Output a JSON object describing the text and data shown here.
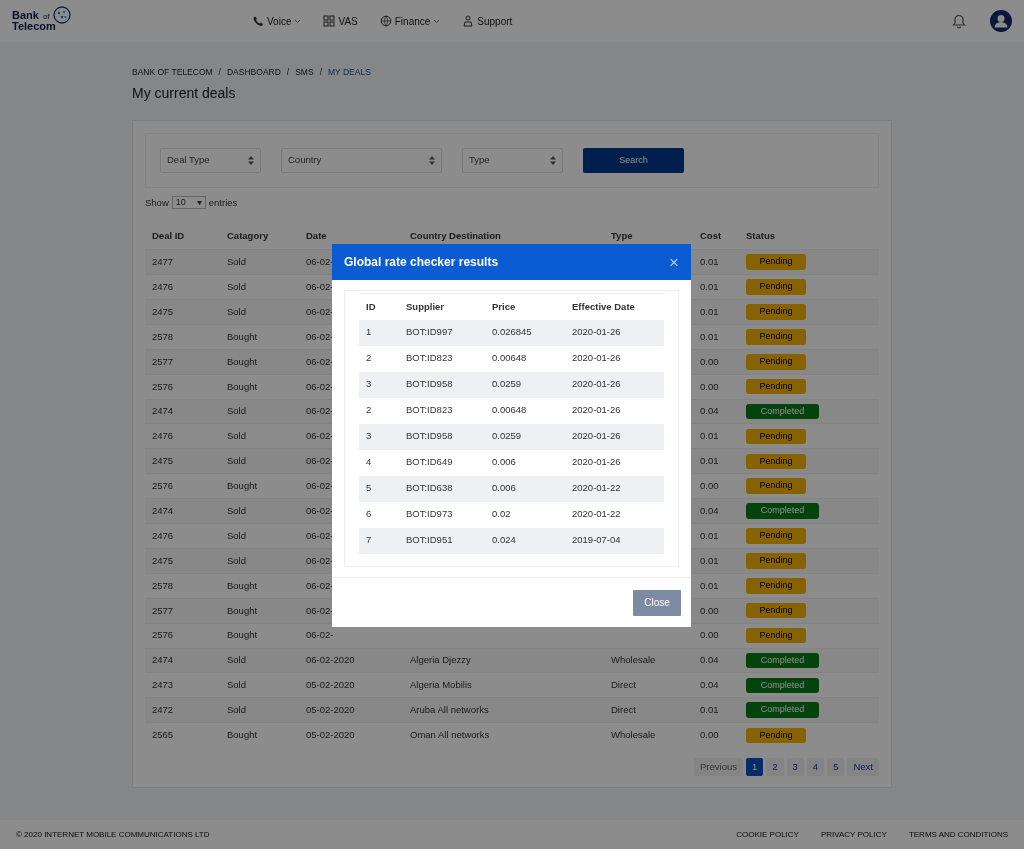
{
  "brand": {
    "line1": "Bank",
    "small": "of",
    "line2": "Telecom"
  },
  "nav": [
    {
      "label": "Voice",
      "kind": "phone",
      "dropdown": true
    },
    {
      "label": "VAS",
      "kind": "grid",
      "dropdown": false
    },
    {
      "label": "Finance",
      "kind": "globe",
      "dropdown": true
    },
    {
      "label": "Support",
      "kind": "support",
      "dropdown": false
    }
  ],
  "breadcrumb_separator": "/",
  "breadcrumb": [
    {
      "label": "BANK OF TELECOM",
      "selected": false
    },
    {
      "label": "DASHBOARD",
      "selected": false
    },
    {
      "label": "SMS",
      "selected": false
    },
    {
      "label": "MY DEALS",
      "selected": true
    }
  ],
  "page_title": "My current deals",
  "filters": {
    "selects": [
      {
        "placeholder": "Deal Type"
      },
      {
        "placeholder": "Country"
      },
      {
        "placeholder": "Type"
      }
    ],
    "search_button": "Search"
  },
  "length": {
    "before": "Show",
    "value": "10",
    "after": "entries"
  },
  "table": {
    "columns": [
      "Deal ID",
      "Catagory",
      "Date",
      "Country Destination",
      "Type",
      "Cost",
      "Status"
    ],
    "rows": [
      {
        "id": "2477",
        "category": "Sold",
        "date": "06-02-",
        "cost": "0.01",
        "status": "Pending",
        "kind": "pending"
      },
      {
        "id": "2476",
        "category": "Sold",
        "date": "06-02-",
        "cost": "0.01",
        "status": "Pending",
        "kind": "pending"
      },
      {
        "id": "2475",
        "category": "Sold",
        "date": "06-02-",
        "cost": "0.01",
        "status": "Pending",
        "kind": "pending"
      },
      {
        "id": "2578",
        "category": "Bought",
        "date": "06-02-",
        "cost": "0.01",
        "status": "Pending",
        "kind": "pending"
      },
      {
        "id": "2577",
        "category": "Bought",
        "date": "06-02-",
        "cost": "0.00",
        "status": "Pending",
        "kind": "pending"
      },
      {
        "id": "2576",
        "category": "Bought",
        "date": "06-02-",
        "cost": "0.00",
        "status": "Pending",
        "kind": "pending"
      },
      {
        "id": "2474",
        "category": "Sold",
        "date": "06-02-",
        "cost": "0.04",
        "status": "Completed",
        "kind": "completed"
      },
      {
        "id": "2476",
        "category": "Sold",
        "date": "06-02-",
        "cost": "0.01",
        "status": "Pending",
        "kind": "pending"
      },
      {
        "id": "2475",
        "category": "Sold",
        "date": "06-02-",
        "cost": "0.01",
        "status": "Pending",
        "kind": "pending"
      },
      {
        "id": "2576",
        "category": "Bought",
        "date": "06-02-",
        "cost": "0.00",
        "status": "Pending",
        "kind": "pending"
      },
      {
        "id": "2474",
        "category": "Sold",
        "date": "06-02-",
        "cost": "0.04",
        "status": "Completed",
        "kind": "completed"
      },
      {
        "id": "2476",
        "category": "Sold",
        "date": "06-02-",
        "cost": "0.01",
        "status": "Pending",
        "kind": "pending"
      },
      {
        "id": "2475",
        "category": "Sold",
        "date": "06-02-",
        "cost": "0.01",
        "status": "Pending",
        "kind": "pending"
      },
      {
        "id": "2578",
        "category": "Bought",
        "date": "06-02-",
        "cost": "0.01",
        "status": "Pending",
        "kind": "pending"
      },
      {
        "id": "2577",
        "category": "Bought",
        "date": "06-02-",
        "cost": "0.00",
        "status": "Pending",
        "kind": "pending"
      },
      {
        "id": "2576",
        "category": "Bought",
        "date": "06-02-",
        "cost": "0.00",
        "status": "Pending",
        "kind": "pending"
      },
      {
        "id": "2474",
        "category": "Sold",
        "date": "06-02-2020",
        "country": "Algeria Djezzy",
        "type": "Wholesale",
        "cost": "0.04",
        "status": "Completed",
        "kind": "completed"
      },
      {
        "id": "2473",
        "category": "Sold",
        "date": "05-02-2020",
        "country": "Algeria Mobilis",
        "type": "Direct",
        "cost": "0.04",
        "status": "Completed",
        "kind": "completed"
      },
      {
        "id": "2472",
        "category": "Sold",
        "date": "05-02-2020",
        "country": "Aruba All networks",
        "type": "Direct",
        "cost": "0.01",
        "status": "Completed",
        "kind": "completed"
      },
      {
        "id": "2565",
        "category": "Bought",
        "date": "05-02-2020",
        "country": "Oman All networks",
        "type": "Wholesale",
        "cost": "0.00",
        "status": "Pending",
        "kind": "pending"
      }
    ]
  },
  "pagination": [
    {
      "label": "Previous",
      "selected": false,
      "disabled": true
    },
    {
      "label": "1",
      "selected": true,
      "disabled": false
    },
    {
      "label": "2",
      "selected": false,
      "disabled": false
    },
    {
      "label": "3",
      "selected": false,
      "disabled": false
    },
    {
      "label": "4",
      "selected": false,
      "disabled": false
    },
    {
      "label": "5",
      "selected": false,
      "disabled": false
    },
    {
      "label": "Next",
      "selected": false,
      "disabled": false
    }
  ],
  "footer": {
    "copyright": "© 2020 INTERNET MOBILE COMMUNICATIONS LTD",
    "links": [
      "COOKIE POLICY",
      "PRIVACY POLICY",
      "TERMS AND CONDITIONS"
    ]
  },
  "modal": {
    "title": "Global rate checker results",
    "close_icon": "×",
    "columns": [
      "ID",
      "Supplier",
      "Price",
      "Effective Date"
    ],
    "rows": [
      [
        "1",
        "BOT:ID997",
        "0.026845",
        "2020-01-26"
      ],
      [
        "2",
        "BOT:ID823",
        "0.00648",
        "2020-01-26"
      ],
      [
        "3",
        "BOT:ID958",
        "0.0259",
        "2020-01-26"
      ],
      [
        "2",
        "BOT:ID823",
        "0.00648",
        "2020-01-26"
      ],
      [
        "3",
        "BOT:ID958",
        "0.0259",
        "2020-01-26"
      ],
      [
        "4",
        "BOT:ID649",
        "0.006",
        "2020-01-26"
      ],
      [
        "5",
        "BOT:ID638",
        "0.006",
        "2020-01-22"
      ],
      [
        "6",
        "BOT:ID973",
        "0.02",
        "2020-01-22"
      ],
      [
        "7",
        "BOT:ID951",
        "0.024",
        "2019-07-04"
      ]
    ],
    "close_button": "Close"
  }
}
